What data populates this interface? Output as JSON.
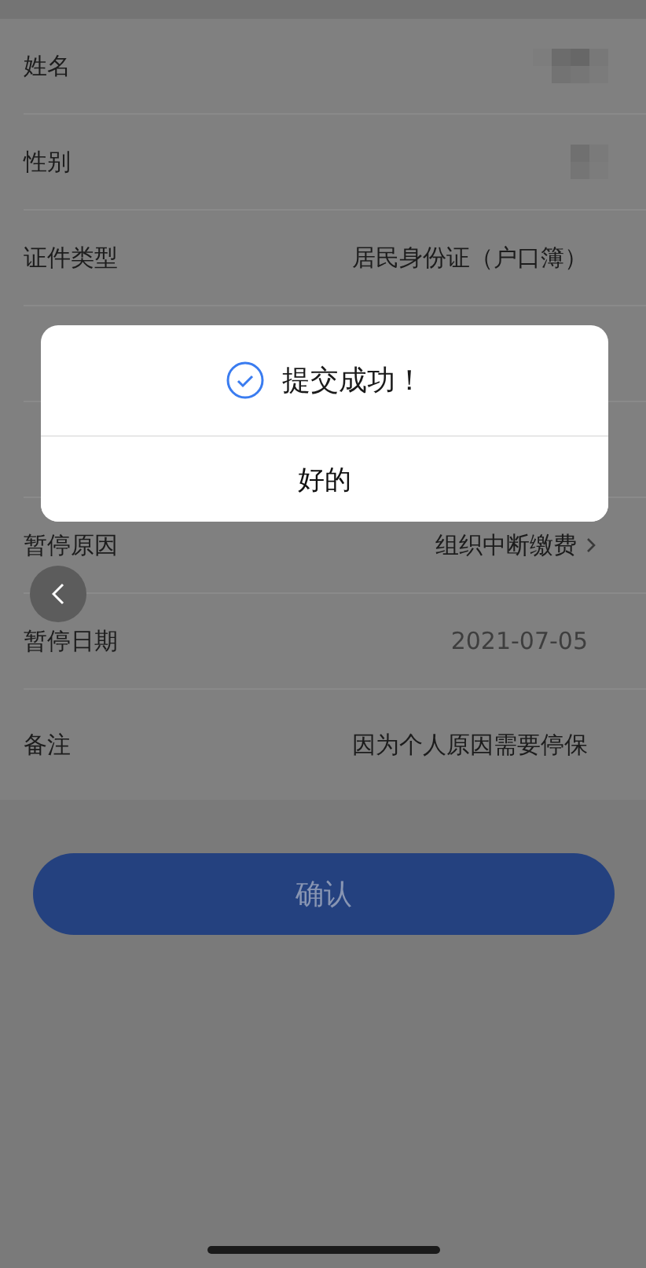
{
  "form": {
    "rows": [
      {
        "label": "姓名",
        "kind": "mosaic"
      },
      {
        "label": "性别",
        "kind": "mosaic"
      },
      {
        "label": "证件类型",
        "kind": "text",
        "value": "居民身份证（户口簿）"
      },
      {
        "kind": "covered"
      },
      {
        "kind": "covered"
      },
      {
        "label": "暂停原因",
        "kind": "select",
        "value": "组织中断缴费"
      },
      {
        "label": "暂停日期",
        "kind": "muted",
        "value": "2021-07-05"
      },
      {
        "label": "备注",
        "kind": "text",
        "value": "因为个人原因需要停保"
      }
    ]
  },
  "submit_button": {
    "label": "确认",
    "disabled": true
  },
  "dialog": {
    "message": "提交成功！",
    "button": "好的"
  }
}
